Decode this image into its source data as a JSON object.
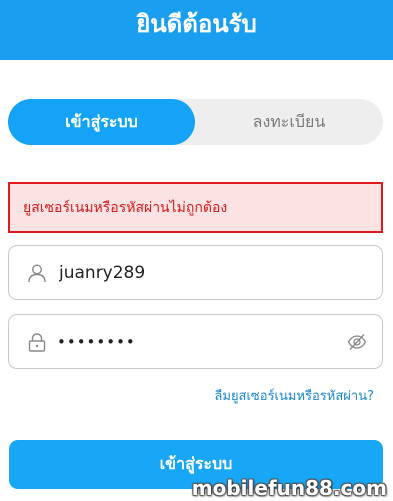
{
  "header": {
    "title": "ยินดีต้อนรับ"
  },
  "tabs": {
    "login": "เข้าสู่ระบบ",
    "register": "ลงทะเบียน"
  },
  "error": {
    "message": "ยูสเซอร์เนมหรือรหัสผ่านไม่ถูกต้อง"
  },
  "form": {
    "username_value": "juanry289",
    "password_masked": "••••••••",
    "forgot_label": "ลืมยูสเซอร์เนมหรือรหัสผ่าน?",
    "submit_label": "เข้าสู่ระบบ"
  },
  "watermark": "mobilefun88.com",
  "colors": {
    "header_bg": "#1a9ff0",
    "accent": "#14a3f7",
    "error_border": "#e0191e",
    "error_bg": "#fbe3e4",
    "link": "#1a86d6"
  },
  "icons": {
    "username": "user-icon",
    "password": "lock-icon",
    "toggle": "eye-off-icon"
  }
}
